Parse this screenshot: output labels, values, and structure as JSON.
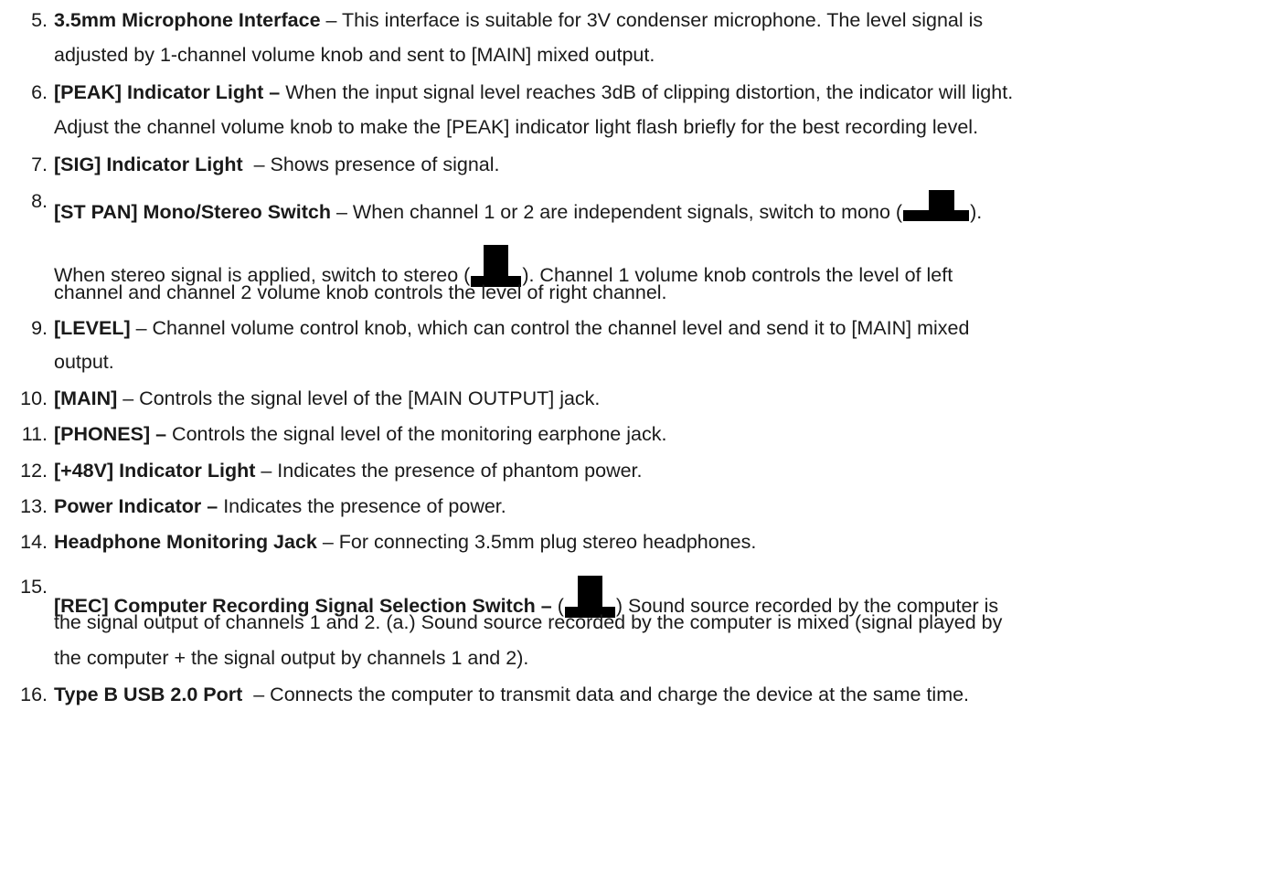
{
  "items": [
    {
      "num": "5.",
      "title": "3.5mm Microphone Interface",
      "l1": " – This interface is suitable for 3V condenser microphone. The level signal is",
      "l2": "adjusted by 1-channel volume knob and sent to [MAIN] mixed output."
    },
    {
      "num": "6.",
      "title": "[PEAK] Indicator Light –",
      "l1": " When the input signal level reaches 3dB of clipping distortion, the indicator will light.",
      "l2": "Adjust the channel volume knob to make the [PEAK] indicator light flash briefly for the best recording level."
    },
    {
      "num": "7.",
      "title": "[SIG] Indicator Light",
      "l1": "  – Shows presence of signal."
    },
    {
      "num": "8.",
      "title": "[ST PAN] Mono/Stereo Switch",
      "l1a": " – When channel 1 or 2 are independent signals, switch to mono (",
      "l1b": ").",
      "l2a": "When stereo signal is applied, switch to stereo (",
      "l2b": "). Channel 1 volume knob controls the level of left",
      "l3": "channel and channel 2 volume knob controls the level of right channel."
    },
    {
      "num": "9.",
      "title": "[LEVEL]",
      "l1": " – Channel volume control knob, which can control the channel level and send it to [MAIN] mixed",
      "l2": "output."
    },
    {
      "num": "10.",
      "title": "[MAIN]",
      "l1": " – Controls the signal level of the [MAIN OUTPUT] jack."
    },
    {
      "num": "11.",
      "title": "[PHONES] –",
      "l1": " Controls the signal level of the monitoring earphone jack."
    },
    {
      "num": "12.",
      "title": "[+48V] Indicator Light",
      "l1": " – Indicates the presence of phantom power."
    },
    {
      "num": "13.",
      "title": "Power Indicator –",
      "l1": " Indicates the presence of power."
    },
    {
      "num": "14.",
      "title": "Headphone Monitoring Jack",
      "l1": " – For connecting 3.5mm plug stereo headphones."
    },
    {
      "num": "15.",
      "title": "[REC] Computer Recording Signal Selection Switch –",
      "l1a": " (",
      "l1b": ") Sound source recorded by the computer is",
      "l2": "the signal output of channels 1 and 2. (a.) Sound source recorded by the computer is mixed (signal played by",
      "l3": "the computer + the signal output by channels 1 and 2)."
    },
    {
      "num": "16.",
      "title": "Type B USB 2.0 Port",
      "l1": "  – Connects the computer to transmit data and charge the device at the same time."
    }
  ]
}
